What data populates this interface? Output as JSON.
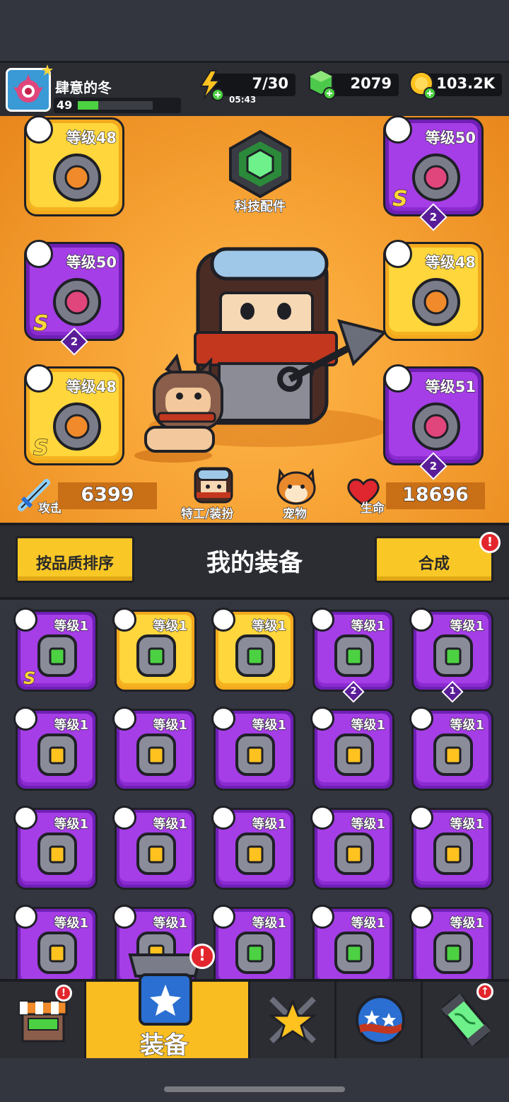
{
  "player": {
    "name": "肆意的冬",
    "level": "49",
    "level_progress": 0.27
  },
  "resources": {
    "energy": "7/30",
    "energy_timer": "05:43",
    "gems": "2079",
    "coins": "103.2K"
  },
  "tech": {
    "label": "科技配件"
  },
  "equipped": [
    {
      "level": "等级48",
      "rarity": "gold",
      "type": "weapon-icon",
      "item": "kunai-icon",
      "s": "",
      "count": ""
    },
    {
      "level": "等级50",
      "rarity": "purple",
      "type": "armor-icon",
      "item": "armor-icon",
      "s": "S",
      "count": "2"
    },
    {
      "level": "等级50",
      "rarity": "purple",
      "type": "necklace-icon",
      "item": "necklace-icon",
      "s": "S",
      "count": "2"
    },
    {
      "level": "等级48",
      "rarity": "gold",
      "type": "belt-icon",
      "item": "belt-icon",
      "s": "",
      "count": ""
    },
    {
      "level": "等级48",
      "rarity": "gold",
      "type": "glove-icon",
      "item": "glove-icon",
      "s": "S",
      "count": ""
    },
    {
      "level": "等级51",
      "rarity": "purple",
      "type": "boots-icon",
      "item": "boots-icon",
      "s": "",
      "count": "2"
    }
  ],
  "stats": {
    "attack_label": "攻击",
    "attack_value": "6399",
    "hp_label": "生命",
    "hp_value": "18696",
    "agent_label": "特工/装扮",
    "pet_label": "宠物"
  },
  "inventory": {
    "title": "我的装备",
    "sort_label": "按品质排序",
    "merge_label": "合成",
    "items": [
      {
        "level": "等级1",
        "rarity": "purple",
        "s": "S",
        "count": "",
        "icon": "belt-icon"
      },
      {
        "level": "等级1",
        "rarity": "gold",
        "s": "",
        "count": "",
        "icon": "bat-icon"
      },
      {
        "level": "等级1",
        "rarity": "gold",
        "s": "",
        "count": "",
        "icon": "belt-icon"
      },
      {
        "level": "等级1",
        "rarity": "purple",
        "s": "",
        "count": "2",
        "icon": "collar-icon"
      },
      {
        "level": "等级1",
        "rarity": "purple",
        "s": "",
        "count": "1",
        "icon": "glove-icon"
      },
      {
        "level": "等级1",
        "rarity": "purple",
        "s": "",
        "count": "",
        "icon": "armor-icon"
      },
      {
        "level": "等级1",
        "rarity": "purple",
        "s": "",
        "count": "",
        "icon": "armor-icon"
      },
      {
        "level": "等级1",
        "rarity": "purple",
        "s": "",
        "count": "",
        "icon": "armor-icon"
      },
      {
        "level": "等级1",
        "rarity": "purple",
        "s": "",
        "count": "",
        "icon": "armor-icon"
      },
      {
        "level": "等级1",
        "rarity": "purple",
        "s": "",
        "count": "",
        "icon": "armor-icon"
      },
      {
        "level": "等级1",
        "rarity": "purple",
        "s": "",
        "count": "",
        "icon": "armor-icon"
      },
      {
        "level": "等级1",
        "rarity": "purple",
        "s": "",
        "count": "",
        "icon": "armor-icon"
      },
      {
        "level": "等级1",
        "rarity": "purple",
        "s": "",
        "count": "",
        "icon": "armor-icon"
      },
      {
        "level": "等级1",
        "rarity": "purple",
        "s": "",
        "count": "",
        "icon": "armor-icon"
      },
      {
        "level": "等级1",
        "rarity": "purple",
        "s": "",
        "count": "",
        "icon": "armor-icon"
      },
      {
        "level": "等级1",
        "rarity": "purple",
        "s": "",
        "count": "",
        "icon": "armor-icon"
      },
      {
        "level": "等级1",
        "rarity": "purple",
        "s": "",
        "count": "",
        "icon": "armor-icon"
      },
      {
        "level": "等级1",
        "rarity": "purple",
        "s": "",
        "count": "",
        "icon": "fang-necklace-icon"
      },
      {
        "level": "等级1",
        "rarity": "purple",
        "s": "",
        "count": "",
        "icon": "fang-necklace-icon"
      },
      {
        "level": "等级1",
        "rarity": "purple",
        "s": "",
        "count": "",
        "icon": "gem-necklace-icon"
      }
    ]
  },
  "nav": {
    "active_label": "装备",
    "tabs": [
      "shop-icon",
      "equipment-icon",
      "star-swords-icon",
      "orb-icon",
      "dna-capsule-icon"
    ]
  },
  "colors": {
    "orange_bg": "#f7a335",
    "gold": "#ffd63b",
    "purple": "#a53ee6",
    "accent_red": "#e3262d",
    "green": "#4cd142"
  }
}
